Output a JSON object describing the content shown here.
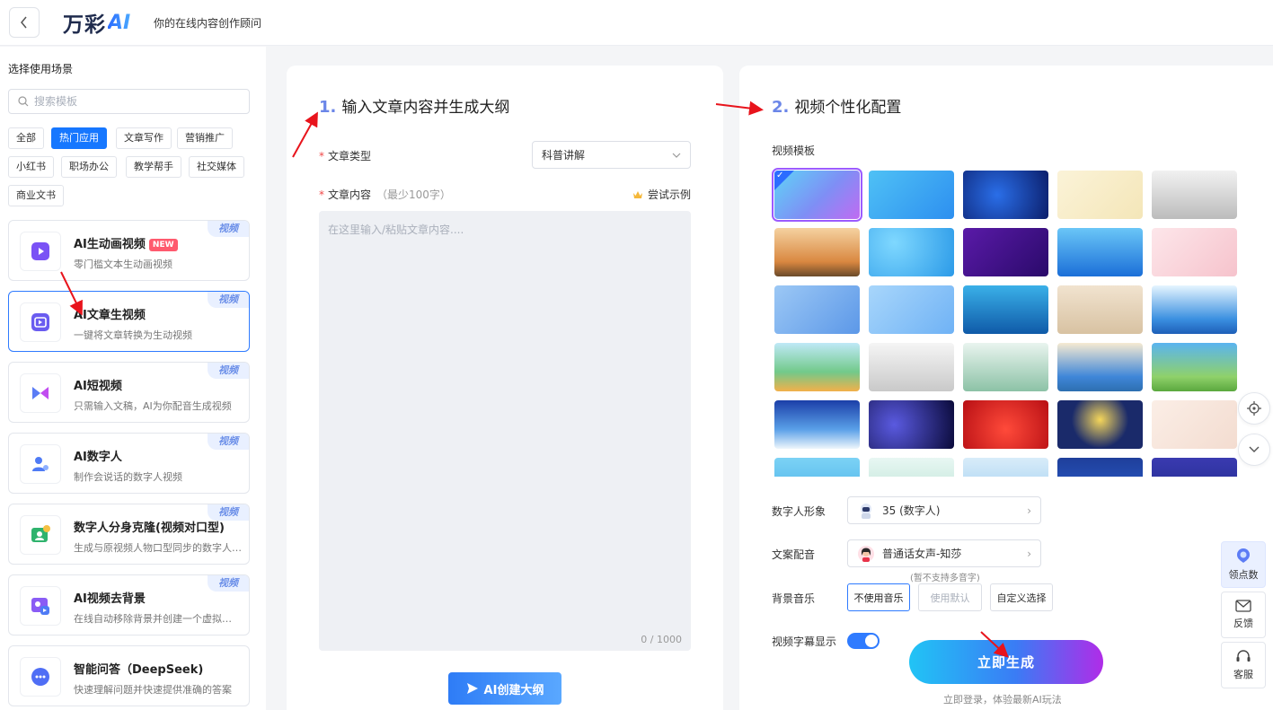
{
  "header": {
    "logo_text": "万彩",
    "logo_ai": "AI",
    "slogan": "你的在线内容创作顾问"
  },
  "sidebar": {
    "title": "选择使用场景",
    "search_placeholder": "搜索模板",
    "tags": [
      "全部",
      "热门应用",
      "文章写作",
      "营销推广",
      "小红书",
      "职场办公",
      "教学帮手",
      "社交媒体",
      "商业文书"
    ],
    "active_tag": "热门应用",
    "cards": [
      {
        "title": "AI生动画视频",
        "badge": "NEW",
        "desc": "零门槛文本生动画视频",
        "corner": "视频"
      },
      {
        "title": "AI文章生视频",
        "desc": "一键将文章转换为生动视频",
        "corner": "视频"
      },
      {
        "title": "AI短视频",
        "desc": "只需输入文稿，AI为你配音生成视频",
        "corner": "视频"
      },
      {
        "title": "AI数字人",
        "desc": "制作会说话的数字人视频",
        "corner": "视频"
      },
      {
        "title": "数字人分身克隆(视频对口型)",
        "desc": "生成与原视频人物口型同步的数字人…",
        "corner": "视频"
      },
      {
        "title": "AI视频去背景",
        "desc": "在线自动移除背景并创建一个虚拟…",
        "corner": "视频"
      },
      {
        "title": "智能问答（DeepSeek)",
        "desc": "快速理解问题并快速提供准确的答案"
      }
    ],
    "selected_card": "AI文章生视频"
  },
  "step1": {
    "num": "1.",
    "title": "输入文章内容并生成大纲",
    "required_mark": "*",
    "type_label": "文章类型",
    "type_value": "科普讲解",
    "content_label": "文章内容",
    "content_hint": "（最少100字）",
    "try_example": "尝试示例",
    "content_placeholder": "在这里输入/粘贴文章内容....",
    "counter": "0 / 1000",
    "outline_button": "AI创建大纲"
  },
  "step2": {
    "num": "2.",
    "title": "视频个性化配置",
    "template_label": "视频模板",
    "digital_human_label": "数字人形象",
    "digital_human_value": "35 (数字人)",
    "voice_label": "文案配音",
    "voice_value": "普通话女声-知莎",
    "voice_note": "(暂不支持多音字)",
    "music_label": "背景音乐",
    "music_options": [
      "不使用音乐",
      "使用默认",
      "自定义选择"
    ],
    "music_selected": "不使用音乐",
    "subtitle_label": "视频字幕显示",
    "subtitle_on": true,
    "generate_button": "立即生成",
    "login_hint": "立即登录，体验最新AI玩法"
  },
  "float_tools": {
    "points": "领点数",
    "feedback": "反馈",
    "service": "客服"
  },
  "colors": {
    "primary": "#1677ff",
    "accent_number": "#6b86e8",
    "required": "#f04848",
    "annotation": "#e8141c"
  }
}
